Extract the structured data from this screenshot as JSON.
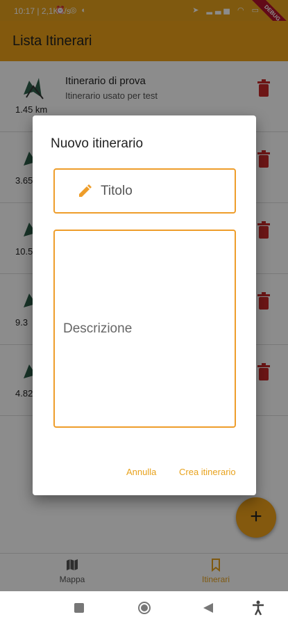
{
  "status_bar": {
    "time": "10:17",
    "network_speed": "2,1KB/s",
    "debug_banner": "DEBUG"
  },
  "app_bar": {
    "title": "Lista Itinerari"
  },
  "itineraries": [
    {
      "title": "Itinerario di prova",
      "description": "Itinerario usato per test",
      "distance": "1.45 km"
    },
    {
      "title": "",
      "description": "",
      "distance": "3.65"
    },
    {
      "title": "",
      "description": "",
      "distance": "10.5"
    },
    {
      "title": "",
      "description": "",
      "distance": "9.3"
    },
    {
      "title": "",
      "description": "",
      "distance": "4.82"
    }
  ],
  "dialog": {
    "title": "Nuovo itinerario",
    "title_field": {
      "placeholder": "Titolo",
      "value": ""
    },
    "description_field": {
      "placeholder": "Descrizione",
      "value": ""
    },
    "cancel_label": "Annulla",
    "create_label": "Crea itinerario"
  },
  "fab": {
    "label": "+"
  },
  "bottom_nav": {
    "items": [
      {
        "label": "Mappa",
        "icon": "map-icon"
      },
      {
        "label": "Itinerari",
        "icon": "bookmark-icon",
        "selected": true
      }
    ]
  },
  "colors": {
    "accent": "#eea318",
    "delete": "#c62828"
  }
}
